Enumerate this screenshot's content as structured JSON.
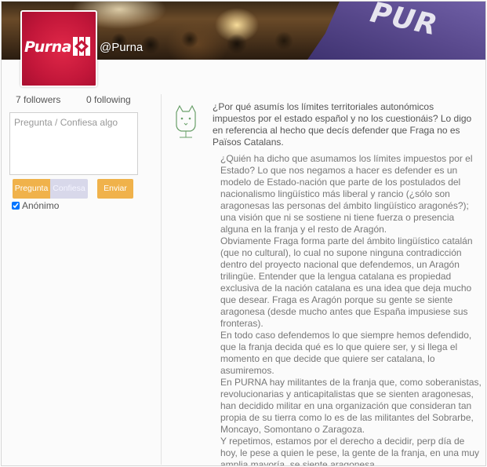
{
  "profile": {
    "username": "@Purna",
    "logo_text": "Purna",
    "followers_label": "7 followers",
    "following_label": "0 following"
  },
  "ask": {
    "placeholder": "Pregunta / Confiesa algo",
    "mode_question": "Pregunta",
    "mode_confess": "Confiesa",
    "send_label": "Enviar",
    "anonymous_label": "Anónimo",
    "anonymous_checked": true
  },
  "post": {
    "question": "¿Por qué asumís los límites territoriales autonómicos impuestos por el estado español y no los cuestionáis? Lo digo en referencia al hecho que decís defender que Fraga no es Països Catalans.",
    "answer": [
      "¿Quién ha dicho que asumamos los límites impuestos por el Estado? Lo que nos negamos a hacer es defender es un modelo de Estado-nación que parte de los postulados del nacionalismo lingüístico más liberal y rancio (¿sólo son aragonesas las personas del ámbito lingüístico aragonés?); una visión que ni se sostiene ni tiene fuerza o presencia alguna en la franja y el resto de Aragón.",
      "Obviamente Fraga forma parte del ámbito lingüístico catalán (que no cultural), lo cual no supone ninguna contradicción dentro del proyecto nacional que defendemos, un Aragón trilingüe. Entender que la lengua catalana es propiedad exclusiva de la nación catalana es una idea que deja mucho que desear. Fraga es Aragón porque su gente se siente aragonesa (desde mucho antes que España impusiese sus fronteras).",
      "En todo caso defendemos lo que siempre hemos defendido, que la franja decida qué es lo que quiere ser, y si llega el momento en que decide que quiere ser catalana, lo asumiremos.",
      "En PURNA hay militantes de la franja que, como soberanistas, revolucionarias y anticapitalistas que se sienten aragonesas, han decidido militar en una organización que consideran tan propia de su tierra como lo es de las militantes del Sobrarbe, Moncayo, Somontano o Zaragoza.",
      "Y repetimos, estamos por el derecho a decidir, perp día de hoy, le pese a quien le pese, la gente de la franja, en una muy amplia mayoría, se siente aragonesa."
    ]
  },
  "colors": {
    "accent": "#f0b24b",
    "brand": "#c3173a",
    "flag": "#5a4a8e"
  },
  "icons": {
    "avatar": "purna-logo",
    "post_avatar": "cat-outline-icon",
    "anonymous": "checkbox"
  }
}
